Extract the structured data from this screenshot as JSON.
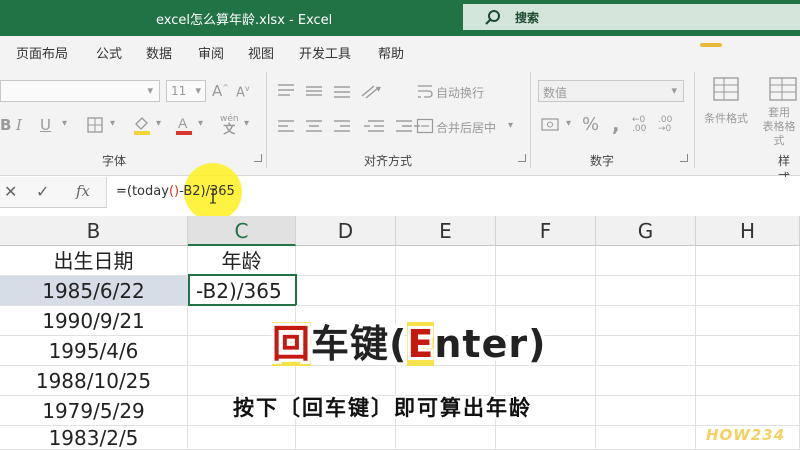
{
  "window": {
    "title": "excel怎么算年龄.xlsx  -  Excel",
    "search_label": "搜索",
    "accent": "#217346"
  },
  "menu": {
    "items": [
      "页面布局",
      "公式",
      "数据",
      "审阅",
      "视图",
      "开发工具",
      "帮助"
    ]
  },
  "ribbon": {
    "font_size": "11",
    "wrap_text": "自动换行",
    "merge_center": "合并后居中",
    "number_format": "数值",
    "conditional_format": "条件格式",
    "table_format": "套用\n表格格式",
    "style_label": "样式",
    "groups": {
      "font": "字体",
      "alignment": "对齐方式",
      "number": "数字"
    }
  },
  "formula_bar": {
    "formula_prefix": "=(today",
    "formula_paren": "()",
    "formula_suffix": "-B2)/365"
  },
  "columns": [
    "B",
    "C",
    "D",
    "E",
    "F",
    "G",
    "H"
  ],
  "active_column": "C",
  "sheet": {
    "headers": {
      "B": "出生日期",
      "C": "年龄"
    },
    "b_values": [
      "1985/6/22",
      "1990/9/21",
      "1995/4/6",
      "1988/10/25",
      "1979/5/29",
      "1983/2/5"
    ],
    "editing_cell_text": "-B2)/365"
  },
  "overlay": {
    "main_first": "回",
    "main_rest": "车键(",
    "main_e": "E",
    "main_end": "nter)",
    "subtitle": "按下〔回车键〕即可算出年龄",
    "watermark": "HOW234"
  }
}
